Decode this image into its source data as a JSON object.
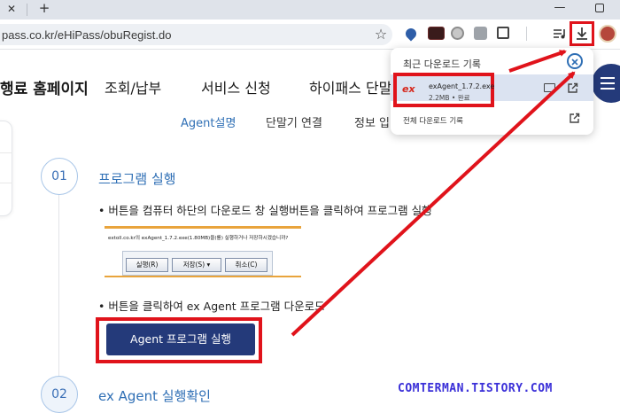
{
  "browser": {
    "tab_close_icon": "✕",
    "new_tab_icon": "+",
    "url": "pass.co.kr/eHiPass/obuRegist.do",
    "bookmark_icon": "☆"
  },
  "site": {
    "title": "행료 홈페이지",
    "nav": [
      "조회/납부",
      "서비스 신청",
      "하이패스 단말기"
    ],
    "subnav": [
      "Agent설명",
      "단말기 연결",
      "정보 입력"
    ]
  },
  "steps": [
    {
      "number": "01",
      "title": "프로그램 실행",
      "bullet1": "버튼을 컴퓨터 하단의 다운로드 창 실행버튼을 클릭하여 프로그램 실행",
      "mini_prompt": "extoll.co.kr의 exAgent_1.7.2.exe(1.80MB)을(를) 실행하거나 저장하시겠습니까?",
      "mini_buttons": [
        "실행(R)",
        "저장(S)",
        "취소(C)"
      ],
      "bullet2": "버튼을 클릭하여 ex Agent 프로그램 다운로드",
      "action_label": "Agent 프로그램 실행"
    },
    {
      "number": "02",
      "title": "ex Agent 실행확인"
    }
  ],
  "downloads_popup": {
    "title": "최근 다운로드 기록",
    "item": {
      "logo": "ex",
      "filename": "exAgent_1.7.2.exe",
      "meta": "2.2MB • 완료"
    },
    "full_history": "전체 다운로드 기록"
  },
  "watermark": "COMTERMAN.TISTORY.COM",
  "colors": {
    "brand_navy": "#243a7a",
    "accent_blue": "#2f6fb5",
    "highlight_red": "#e0131b"
  }
}
